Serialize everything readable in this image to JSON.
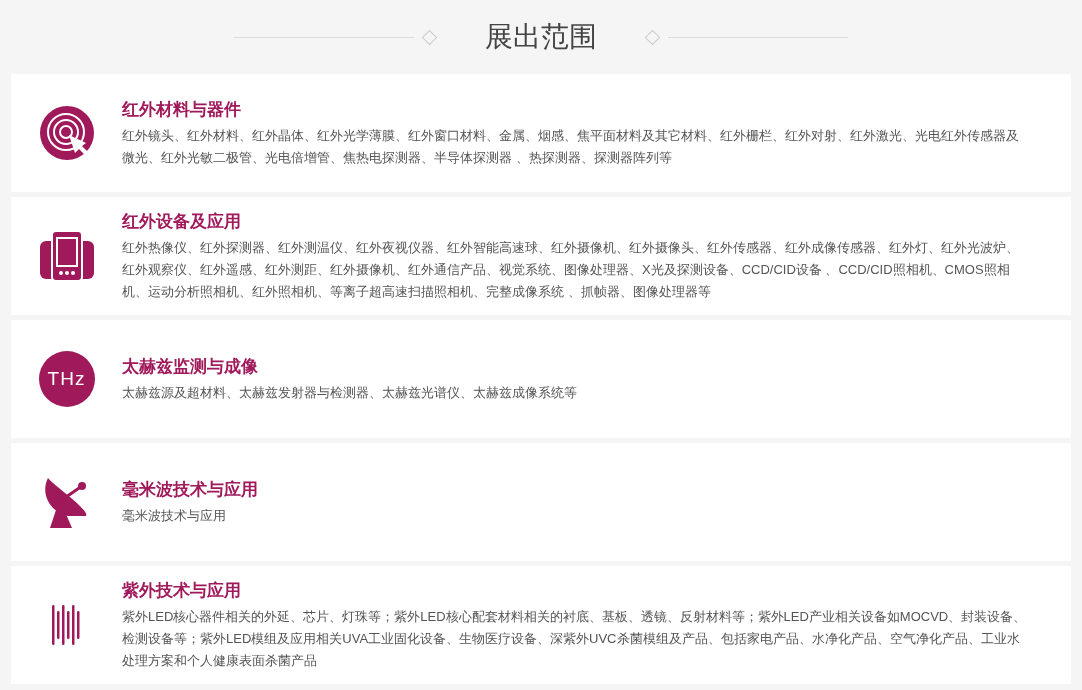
{
  "heading": "展出范围",
  "categories": [
    {
      "kind": "target",
      "title": "红外材料与器件",
      "description": "红外镜头、红外材料、红外晶体、红外光学薄膜、红外窗口材料、金属、烟感、焦平面材料及其它材料、红外栅栏、红外对射、红外激光、光电红外传感器及微光、红外光敏二极管、光电倍增管、焦热电探测器、半导体探测器 、热探测器、探测器阵列等"
    },
    {
      "kind": "device",
      "title": "红外设备及应用",
      "description": "红外热像仪、红外探测器、红外测温仪、红外夜视仪器、红外智能高速球、红外摄像机、红外摄像头、红外传感器、红外成像传感器、红外灯、红外光波炉、红外观察仪、红外遥感、红外测距、红外摄像机、红外通信产品、视觉系统、图像处理器、X光及探测设备、CCD/CID设备 、CCD/CID照相机、CMOS照相机、运动分析照相机、红外照相机、等离子超高速扫描照相机、完整成像系统 、抓帧器、图像处理器等"
    },
    {
      "kind": "thz",
      "icon_text": "THz",
      "title": "太赫兹监测与成像",
      "description": "太赫兹源及超材料、太赫兹发射器与检测器、太赫兹光谱仪、太赫兹成像系统等"
    },
    {
      "kind": "dish",
      "title": "毫米波技术与应用",
      "description": "毫米波技术与应用"
    },
    {
      "kind": "bars",
      "title": "紫外技术与应用",
      "description": "紫外LED核心器件相关的外延、芯片、灯珠等；紫外LED核心配套材料相关的衬底、基板、透镜、反射材料等；紫外LED产业相关设备如MOCVD、封装设备、检测设备等；紫外LED模组及应用相关UVA工业固化设备、生物医疗设备、深紫外UVC杀菌模组及产品、包括家电产品、水净化产品、空气净化产品、工业水处理方案和个人健康表面杀菌产品"
    }
  ]
}
